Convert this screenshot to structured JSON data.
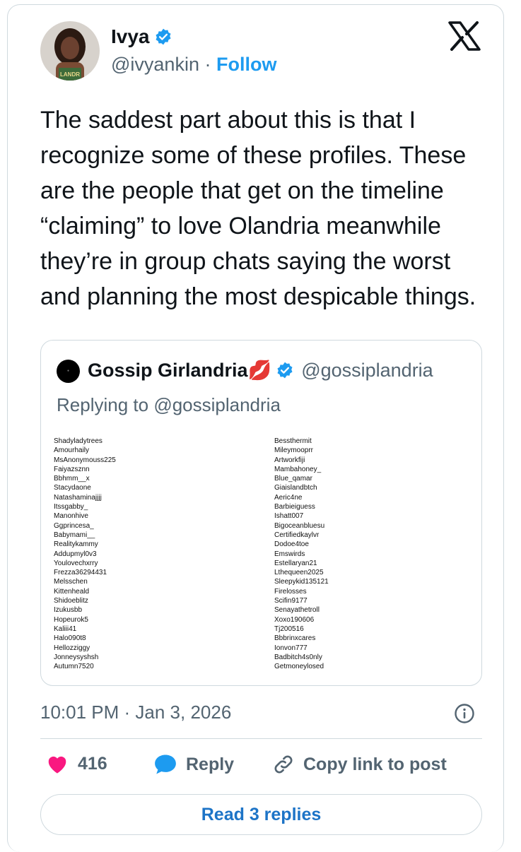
{
  "author": {
    "name": "Ivya",
    "handle": "@ivyankin",
    "separator": "·",
    "follow_label": "Follow"
  },
  "tweet": {
    "text": "The saddest part about this is that I recognize some of these profiles. These are the people that get on the timeline “claiming” to love Olandria meanwhile they’re in group chats saying the worst and planning the most despicable things."
  },
  "quoted": {
    "name": "Gossip Girlandria💋",
    "handle": "@gossiplandria",
    "replying_prefix": "Replying to",
    "replying_handle": "@gossiplandria",
    "list_left": [
      "Shadyladytrees",
      "Amourhaily",
      "MsAnonymouss225",
      "Faiyazsznn",
      "Bbhmm__x",
      "Stacydaone",
      "Natashaminajjjj",
      "Itssgabby_",
      "Manonhive",
      "Ggprincesa_",
      "Babymami__",
      "Realitykammy",
      "Addupmyl0v3",
      "Youlovechxrry",
      "Frezza36294431",
      "Melsschen",
      "Kittenheald",
      "Shidoeblitz",
      "Izukusbb",
      "Hopeurok5",
      "Kaliii41",
      "Halo090t8",
      "Hellozziggy",
      "Jonneysyshsh",
      "Autumn7520"
    ],
    "list_right": [
      "Bessthermit",
      "Mileymooprr",
      "Artworkfiji",
      "Mambahoney_",
      "Blue_qamar",
      "Giaislandbtch",
      "Aeric4ne",
      "Barbieiguess",
      "Ishatt007",
      "Bigoceanbluesu",
      "Certifiedkaylvr",
      "Dodoe4toe",
      "Emswirds",
      "Estellaryan21",
      "Lthequeen2025",
      "Sleepykid135121",
      "Firelosses",
      "Scifin9177",
      "Senayathetroll",
      "Xoxo190606",
      "Tj200516",
      "Bbbrinxcares",
      "Ionvon777",
      "Badbitch4s0nly",
      "Getmoneylosed"
    ]
  },
  "meta": {
    "timestamp": "10:01 PM · Jan 3, 2026"
  },
  "actions": {
    "likes": "416",
    "reply_label": "Reply",
    "copy_label": "Copy link to post"
  },
  "read_replies_label": "Read 3 replies",
  "colors": {
    "accent": "#1d9bf0",
    "like": "#f91880",
    "text": "#0f1419",
    "muted": "#536471",
    "border": "#cfd9de"
  },
  "icons": [
    "verified-badge-icon",
    "x-logo-icon",
    "heart-icon",
    "reply-bubble-icon",
    "link-icon",
    "info-icon",
    "lips-emoji-icon"
  ]
}
